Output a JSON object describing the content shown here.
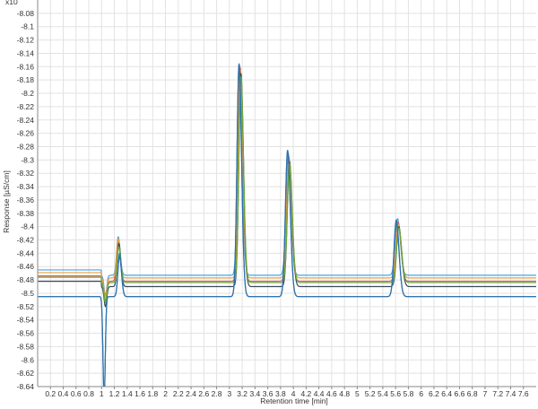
{
  "chart_data": {
    "type": "line",
    "title": "",
    "xlabel": "Retention time [min]",
    "ylabel": "Response [µS/cm]",
    "xlim": [
      0,
      7.8
    ],
    "ylim": [
      -8.64,
      -8.06
    ],
    "y_scale_hint": "x10",
    "x_ticks": [
      "0.2",
      "0.4",
      "0.6",
      "0.8",
      "1",
      "1.2",
      "1.4",
      "1.6",
      "1.8",
      "2",
      "2.2",
      "2.4",
      "2.6",
      "2.8",
      "3",
      "3.2",
      "3.4",
      "3.6",
      "3.8",
      "4",
      "4.2",
      "4.4",
      "4.6",
      "4.8",
      "5",
      "5.2",
      "5.4",
      "5.6",
      "5.8",
      "6",
      "6.2",
      "6.4",
      "6.6",
      "6.8",
      "7",
      "7.2",
      "7.4",
      "7.6"
    ],
    "y_ticks": [
      "-8.08",
      "-8.1",
      "-8.12",
      "-8.14",
      "-8.16",
      "-8.18",
      "-8.2",
      "-8.22",
      "-8.24",
      "-8.26",
      "-8.28",
      "-8.3",
      "-8.32",
      "-8.34",
      "-8.36",
      "-8.38",
      "-8.4",
      "-8.42",
      "-8.44",
      "-8.46",
      "-8.48",
      "-8.5",
      "-8.52",
      "-8.54",
      "-8.56",
      "-8.58",
      "-8.6",
      "-8.62",
      "-8.64"
    ],
    "grid": true,
    "series": [
      {
        "color": "#4aa3df",
        "baseline": -8.473,
        "dip": 0,
        "peaks": [
          {
            "x": 1.26,
            "y": -8.415
          },
          {
            "x": 3.16,
            "y": -8.158
          },
          {
            "x": 3.92,
            "y": -8.29
          },
          {
            "x": 5.63,
            "y": -8.388
          }
        ]
      },
      {
        "color": "#e05a5a",
        "baseline": -8.482,
        "dip": 0,
        "peaks": [
          {
            "x": 1.26,
            "y": -8.42
          },
          {
            "x": 3.17,
            "y": -8.162
          },
          {
            "x": 3.93,
            "y": -8.296
          },
          {
            "x": 5.64,
            "y": -8.393
          }
        ]
      },
      {
        "color": "#e8a040",
        "baseline": -8.477,
        "dip": 0,
        "peaks": [
          {
            "x": 1.26,
            "y": -8.418
          },
          {
            "x": 3.17,
            "y": -8.165
          },
          {
            "x": 3.93,
            "y": -8.3
          },
          {
            "x": 5.64,
            "y": -8.396
          }
        ]
      },
      {
        "color": "#3a4a5a",
        "baseline": -8.49,
        "dip": 0,
        "peaks": [
          {
            "x": 1.27,
            "y": -8.425
          },
          {
            "x": 3.18,
            "y": -8.17
          },
          {
            "x": 3.94,
            "y": -8.302
          },
          {
            "x": 5.65,
            "y": -8.4
          }
        ]
      },
      {
        "color": "#6aaa3a",
        "baseline": -8.484,
        "dip": 0,
        "peaks": [
          {
            "x": 1.27,
            "y": -8.43
          },
          {
            "x": 3.18,
            "y": -8.175
          },
          {
            "x": 3.94,
            "y": -8.305
          },
          {
            "x": 5.65,
            "y": -8.402
          }
        ]
      },
      {
        "color": "#2a8a8a",
        "baseline": -8.505,
        "dip": -8.66,
        "peaks": [
          {
            "x": 1.28,
            "y": -8.44
          },
          {
            "x": 3.15,
            "y": -8.16
          },
          {
            "x": 3.91,
            "y": -8.288
          },
          {
            "x": 5.61,
            "y": -8.395
          }
        ]
      },
      {
        "color": "#2f6fb0",
        "baseline": -8.505,
        "dip": -8.66,
        "peaks": [
          {
            "x": 1.28,
            "y": -8.445
          },
          {
            "x": 3.15,
            "y": -8.155
          },
          {
            "x": 3.91,
            "y": -8.285
          },
          {
            "x": 5.61,
            "y": -8.39
          }
        ]
      }
    ]
  }
}
